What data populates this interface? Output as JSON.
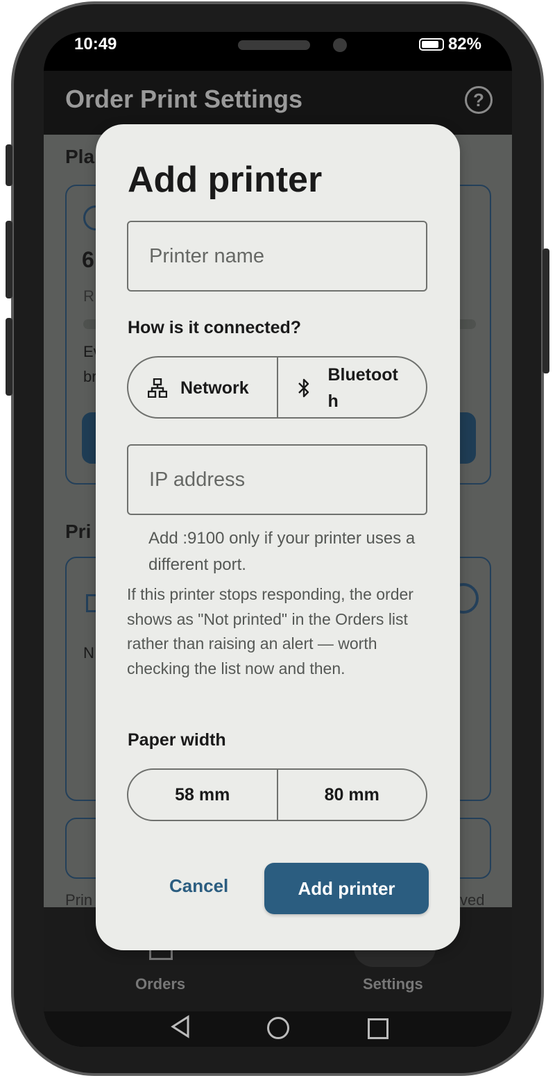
{
  "status": {
    "time": "10:49",
    "battery": "82%"
  },
  "appbar": {
    "title": "Order Print Settings",
    "help_icon": "help-circle-icon"
  },
  "background": {
    "section1_title_visible": "Pla",
    "card_number_visible": "6",
    "card_text_visible": "R",
    "card_text2_visible": "Ev",
    "card_text3_visible": "br",
    "section2_title_visible": "Pri",
    "card2_text_visible": "N",
    "footer_left_visible": "Prin",
    "footer_right_visible": "ved"
  },
  "nav": {
    "orders_label": "Orders",
    "settings_label": "Settings"
  },
  "dialog": {
    "title": "Add printer",
    "printer_name_placeholder": "Printer name",
    "connection_label": "How is it connected?",
    "connection_options": [
      {
        "label": "Network",
        "icon": "network-icon"
      },
      {
        "label_line1": "Bluetoot",
        "label_line2": "h",
        "icon": "bluetooth-icon"
      }
    ],
    "ip_placeholder": "IP address",
    "helper_text": "Add :9100 only if your printer uses a different port.",
    "warning_text": "If this printer stops responding, the order shows as \"Not printed\" in the Orders list rather than raising an alert — worth checking the list now and then.",
    "paper_label": "Paper width",
    "paper_options": [
      "58 mm",
      "80 mm"
    ],
    "cancel_label": "Cancel",
    "confirm_label": "Add printer"
  },
  "colors": {
    "accent": "#2b5d80",
    "dialog_bg": "#ebece9",
    "scrim": "#5b5d5b"
  }
}
